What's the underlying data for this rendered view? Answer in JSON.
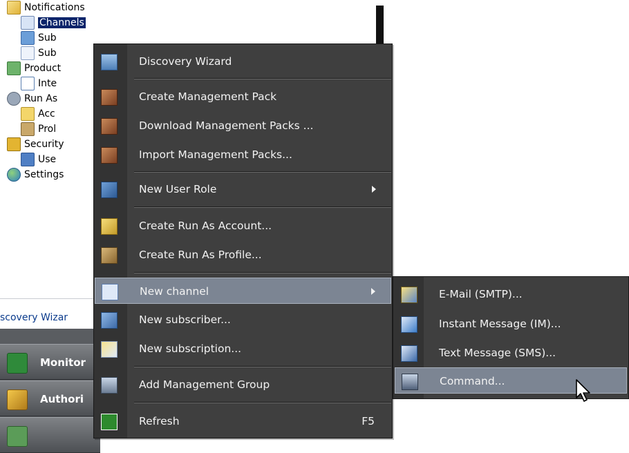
{
  "tree": {
    "items": [
      {
        "label": "Notifications",
        "icon": "envelope-icon"
      },
      {
        "label": "Channels",
        "icon": "channel-icon",
        "selected": true
      },
      {
        "label": "Sub",
        "icon": "subscriber-icon"
      },
      {
        "label": "Sub",
        "icon": "subscription-icon"
      },
      {
        "label": "Product",
        "icon": "product-connector-icon"
      },
      {
        "label": "Inte",
        "icon": "internal-connector-icon"
      },
      {
        "label": "Run As",
        "icon": "run-as-gear-icon"
      },
      {
        "label": "Acc",
        "icon": "account-icon"
      },
      {
        "label": "Prol",
        "icon": "profile-icon"
      },
      {
        "label": "Security",
        "icon": "lock-icon"
      },
      {
        "label": "Use",
        "icon": "user-icon"
      },
      {
        "label": "Settings",
        "icon": "globe-icon"
      }
    ]
  },
  "lower": {
    "link": "scovery Wizar",
    "wunderbar": [
      {
        "label": "Monitor",
        "icon": "monitoring-icon"
      },
      {
        "label": "Authori",
        "icon": "authoring-icon"
      }
    ]
  },
  "context_menu": {
    "items": [
      {
        "label": "Discovery Wizard",
        "icon": "discovery-wizard-icon"
      },
      {
        "label": "Create Management Pack",
        "icon": "management-pack-icon"
      },
      {
        "label": "Download Management Packs ...",
        "icon": "download-pack-icon"
      },
      {
        "label": "Import Management Packs...",
        "icon": "import-pack-icon"
      },
      {
        "label": "New User Role",
        "icon": "user-role-icon",
        "submenu": true
      },
      {
        "label": "Create Run As Account...",
        "icon": "run-as-account-icon"
      },
      {
        "label": "Create Run As Profile...",
        "icon": "run-as-profile-icon"
      },
      {
        "label": "New channel",
        "icon": "channel-icon",
        "submenu": true,
        "highlighted": true
      },
      {
        "label": "New subscriber...",
        "icon": "subscriber-icon"
      },
      {
        "label": "New subscription...",
        "icon": "subscription-icon"
      },
      {
        "label": "Add Management Group",
        "icon": "management-group-icon"
      },
      {
        "label": "Refresh",
        "icon": "refresh-icon",
        "shortcut": "F5"
      }
    ]
  },
  "submenu": {
    "items": [
      {
        "label": "E-Mail (SMTP)...",
        "icon": "email-channel-icon"
      },
      {
        "label": "Instant Message (IM)...",
        "icon": "im-channel-icon"
      },
      {
        "label": "Text Message (SMS)...",
        "icon": "sms-channel-icon"
      },
      {
        "label": "Command...",
        "icon": "command-channel-icon",
        "highlighted": true
      }
    ]
  },
  "colors": {
    "menu_bg": "#3f3f3f",
    "menu_gutter": "#333333",
    "highlight": "#7c8593",
    "selection": "#0a246a"
  }
}
